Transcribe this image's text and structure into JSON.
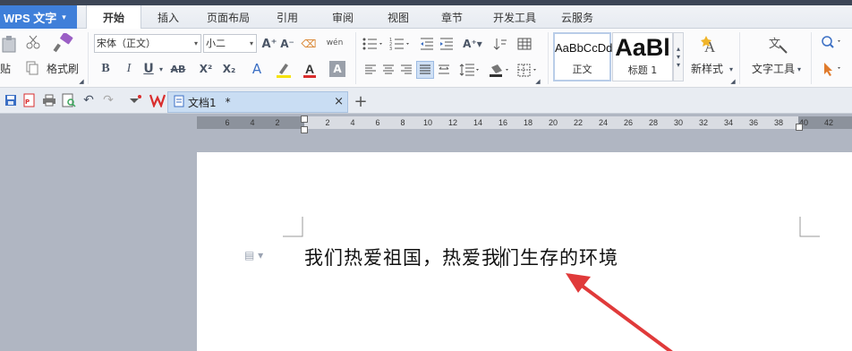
{
  "app": {
    "title": "WPS 文字",
    "menu_tabs": [
      {
        "label": "开始",
        "active": true
      },
      {
        "label": "插入",
        "active": false
      },
      {
        "label": "页面布局",
        "active": false
      },
      {
        "label": "引用",
        "active": false
      },
      {
        "label": "审阅",
        "active": false
      },
      {
        "label": "视图",
        "active": false
      },
      {
        "label": "章节",
        "active": false
      },
      {
        "label": "开发工具",
        "active": false
      },
      {
        "label": "云服务",
        "active": false
      }
    ]
  },
  "ribbon": {
    "paste_label": "贴",
    "format_painter_label": "格式刷",
    "font_name": "宋体（正文）",
    "font_size": "小二",
    "style_normal_sample": "AaBbCcDd",
    "style_normal_name": "正文",
    "style_heading_sample": "AaBl",
    "style_heading_name": "标题 1",
    "new_style_label": "新样式",
    "text_tools_label": "文字工具",
    "bold": "B",
    "italic": "I",
    "underline": "U",
    "strikethrough": "AB",
    "superscript": "X²",
    "subscript": "X₂",
    "font_color_letter": "A",
    "grow_font": "A⁺",
    "shrink_font": "A⁻",
    "phonetic_label": "wén",
    "accent_color": "#d92d2d",
    "highlight_color": "#f5e20a"
  },
  "document": {
    "tab_name": "文档1",
    "modified_mark": "*",
    "text_before_cursor": "我们热爱祖国，热爱我",
    "text_after_cursor": "们生存的环境"
  },
  "ruler": {
    "left_ticks": [
      "6",
      "4",
      "2"
    ],
    "ticks": [
      "2",
      "4",
      "6",
      "8",
      "10",
      "12",
      "14",
      "16",
      "18",
      "20",
      "22",
      "24",
      "26",
      "28",
      "30",
      "32",
      "34",
      "36",
      "38",
      "40",
      "42"
    ]
  },
  "colors": {
    "app_button": "#3f7fd9",
    "arrow": "#e03a3a",
    "doc_tab": "#c9ddf3"
  }
}
